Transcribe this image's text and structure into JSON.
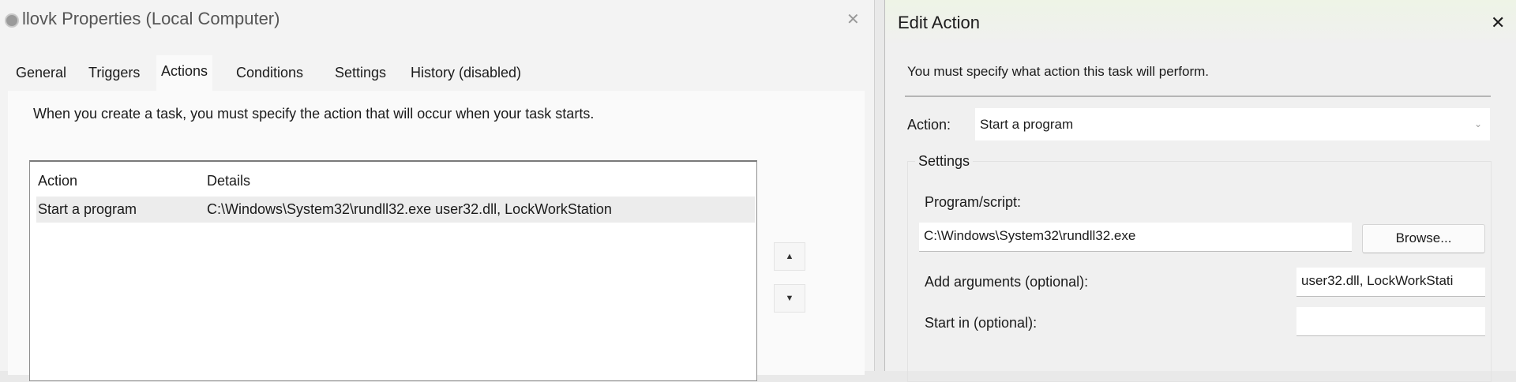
{
  "properties_dialog": {
    "title": "llovk Properties (Local Computer)",
    "tabs": [
      "General",
      "Triggers",
      "Actions",
      "Conditions",
      "Settings",
      "History (disabled)"
    ],
    "selected_tab": "Actions",
    "intro": "When you create a task, you must specify the action that will occur when your task starts.",
    "columns": [
      "Action",
      "Details"
    ],
    "rows": [
      {
        "action": "Start a program",
        "details": "C:\\Windows\\System32\\rundll32.exe user32.dll, LockWorkStation"
      }
    ],
    "move_up": "▲",
    "move_down": "▼",
    "close": "✕"
  },
  "edit_action": {
    "title": "Edit Action",
    "close": "✕",
    "description": "You must specify what action this task will perform.",
    "action_label": "Action:",
    "action_value": "Start a program",
    "settings_label": "Settings",
    "program_label": "Program/script:",
    "program_value": "C:\\Windows\\System32\\rundll32.exe",
    "browse": "Browse...",
    "args_label": "Add arguments (optional):",
    "args_value": "user32.dll, LockWorkStati",
    "startin_label": "Start in (optional):",
    "startin_value": ""
  }
}
